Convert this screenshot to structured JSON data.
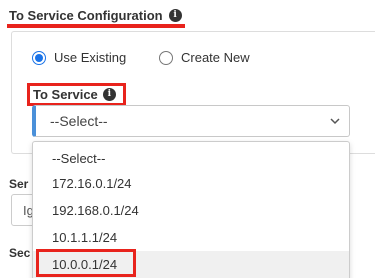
{
  "section": {
    "title": "To Service Configuration",
    "info_icon": "info-icon"
  },
  "radio": {
    "use_existing_label": "Use Existing",
    "create_new_label": "Create New",
    "selected": "Use Existing"
  },
  "to_service": {
    "label": "To Service",
    "info_icon": "info-icon",
    "selected_value": "--Select--",
    "options": [
      "--Select--",
      "172.16.0.1/24",
      "192.168.0.1/24",
      "10.1.1.1/24",
      "10.0.0.1/24"
    ]
  },
  "background": {
    "serv_label": "Ser",
    "input_value": "Ig",
    "sec_label": "Sec"
  },
  "colors": {
    "accent": "#1a73e8",
    "highlight": "#e8231c",
    "select_border": "#4a90d9"
  }
}
